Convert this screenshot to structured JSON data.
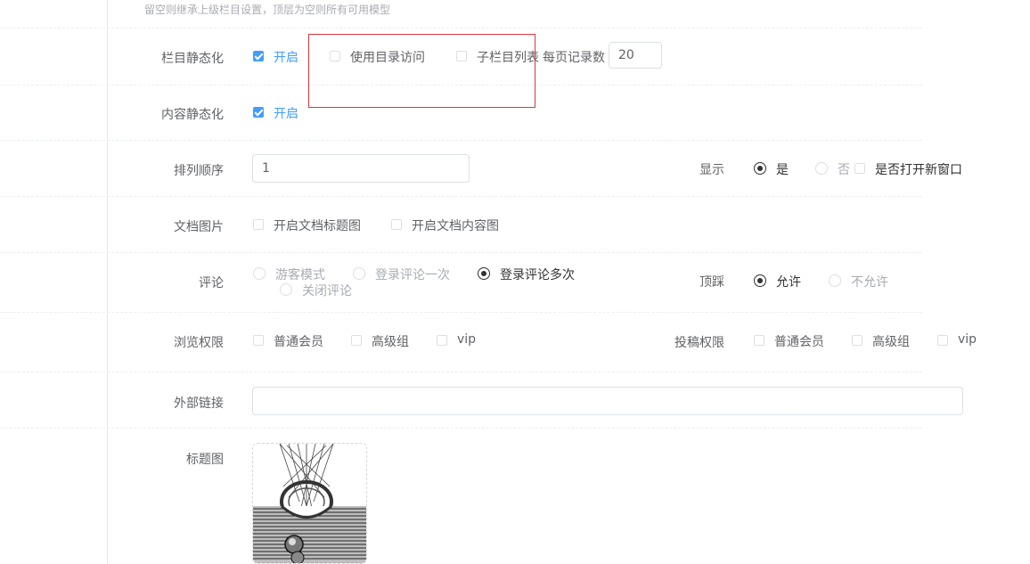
{
  "hint_text": "留空则继承上级栏目设置，顶层为空则所有可用模型",
  "column_static": {
    "label": "栏目静态化",
    "enable_label": "开启",
    "dir_access_label": "使用目录访问",
    "sub_list_label": "子栏目列表",
    "per_page_label": "每页记录数",
    "per_page_value": "20"
  },
  "content_static": {
    "label": "内容静态化",
    "enable_label": "开启"
  },
  "sort": {
    "label": "排列顺序",
    "value": "1",
    "display_label": "显示",
    "yes_label": "是",
    "no_label": "否",
    "new_window_label": "是否打开新窗口"
  },
  "doc_image": {
    "label": "文档图片",
    "title_image_label": "开启文档标题图",
    "content_image_label": "开启文档内容图"
  },
  "comment": {
    "label": "评论",
    "guest_label": "游客模式",
    "login_once_label": "登录评论一次",
    "login_multi_label": "登录评论多次",
    "close_label": "关闭评论",
    "vote_label": "顶踩",
    "allow_label": "允许",
    "disallow_label": "不允许"
  },
  "permissions": {
    "browse_label": "浏览权限",
    "submit_label": "投稿权限",
    "normal_member": "普通会员",
    "advanced_group": "高级组",
    "vip": "vip"
  },
  "external_link": {
    "label": "外部链接",
    "value": ""
  },
  "title_image": {
    "label": "标题图"
  },
  "colors": {
    "accent": "#409eff",
    "highlight_box": "#d9363e"
  }
}
